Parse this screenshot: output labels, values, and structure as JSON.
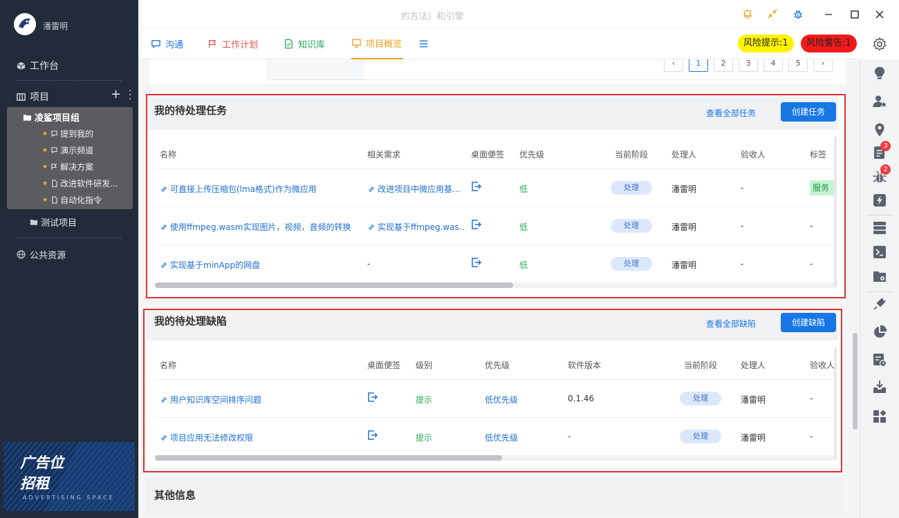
{
  "window": {
    "title": "的方法）和引擎"
  },
  "sidebar": {
    "user": "潘雷明",
    "workbench": "工作台",
    "project": "项目",
    "group": "凌鲨项目组",
    "group_items": [
      "提到我的",
      "演示频道",
      "解决方案",
      "改进软件研发...",
      "自动化指令"
    ],
    "test_project": "测试项目",
    "public": "公共资源",
    "ad": {
      "line1": "广告位",
      "line2": "招租",
      "sub": "ADVERTISING SPACE"
    }
  },
  "tabs": [
    {
      "label": "沟通",
      "color": "#1677e5"
    },
    {
      "label": "工作计划",
      "color": "#e5504a"
    },
    {
      "label": "知识库",
      "color": "#27a85a"
    },
    {
      "label": "项目概览",
      "color": "#f0a020"
    }
  ],
  "risk": {
    "hint": "风险提示:1",
    "warn": "风险警告:1"
  },
  "pagination": {
    "pages": [
      "1",
      "2",
      "3",
      "4",
      "5"
    ]
  },
  "tasks": {
    "title": "我的待处理任务",
    "view_all": "查看全部任务",
    "create": "创建任务",
    "columns": [
      "名称",
      "相关需求",
      "桌面便签",
      "优先级",
      "当前阶段",
      "处理人",
      "验收人",
      "标签"
    ],
    "rows": [
      {
        "name": "可直接上传压缩包(lma格式)作为微应用",
        "req": "改进项目中微应用基...",
        "priority": "低",
        "stage": "处理",
        "handler": "潘雷明",
        "checker": "-",
        "tag": "服务端"
      },
      {
        "name": "使用ffmpeg.wasm实现图片，视频，音频的转换",
        "req": "实现基于ffmpeg.was...",
        "priority": "低",
        "stage": "处理",
        "handler": "潘雷明",
        "checker": "-",
        "tag": "-"
      },
      {
        "name": "实现基于minApp的网盘",
        "req": "-",
        "priority": "低",
        "stage": "处理",
        "handler": "潘雷明",
        "checker": "-",
        "tag": "-"
      }
    ]
  },
  "bugs": {
    "title": "我的待处理缺陷",
    "view_all": "查看全部缺陷",
    "create": "创建缺陷",
    "columns": [
      "名称",
      "桌面便签",
      "级别",
      "优先级",
      "软件版本",
      "当前阶段",
      "处理人",
      "验收人"
    ],
    "rows": [
      {
        "name": "用户知识库空间排序问题",
        "level": "提示",
        "priority": "低优先级",
        "version": "0.1.46",
        "stage": "处理",
        "handler": "潘雷明",
        "checker": "-"
      },
      {
        "name": "项目应用无法修改权限",
        "level": "提示",
        "priority": "低优先级",
        "version": "-",
        "stage": "处理",
        "handler": "潘雷明",
        "checker": "-"
      }
    ]
  },
  "other": {
    "title": "其他信息"
  },
  "rightbar": {
    "badges": [
      "3",
      "2"
    ]
  }
}
